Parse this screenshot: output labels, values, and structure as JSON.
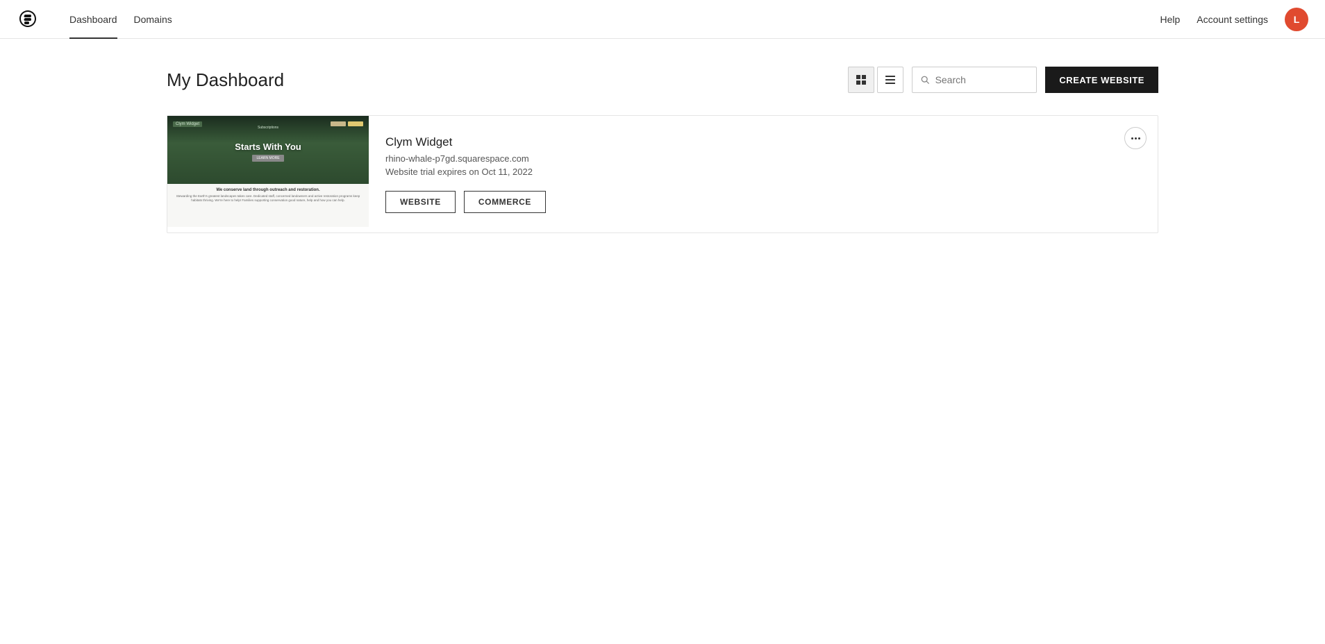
{
  "nav": {
    "links": [
      {
        "label": "Dashboard",
        "active": true
      },
      {
        "label": "Domains",
        "active": false
      }
    ],
    "help_label": "Help",
    "account_label": "Account settings",
    "avatar_letter": "L"
  },
  "dashboard": {
    "title": "My Dashboard",
    "search_placeholder": "Search",
    "create_button_label": "CREATE WEBSITE"
  },
  "site": {
    "name": "Clym Widget",
    "url": "rhino-whale-p7gd.squarespace.com",
    "trial_text": "Website trial expires on Oct 11, 2022",
    "button_website": "WEBSITE",
    "button_commerce": "COMMERCE",
    "thumbnail": {
      "brand_label": "Clym Widget",
      "subtitle": "Subscriptions",
      "headline": "Starts With You",
      "bottom_title": "We conserve land through outreach and restoration.",
      "bottom_text": "Stewarding the Earth's greatest landscapes takes care. Dedicated staff, concerned landowners and active restoration programs keep habitats thriving. We're here to help! Families supporting conservation good nature, help and how you can help."
    }
  }
}
